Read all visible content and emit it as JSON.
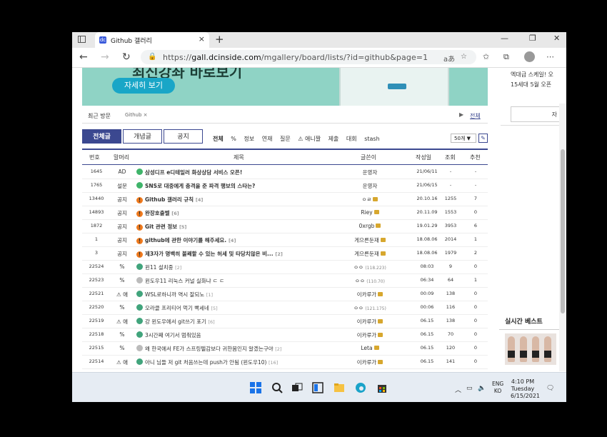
{
  "browser": {
    "tab_title": "Github 갤러리",
    "tab_favicon": "dc",
    "url_prefix": "https://",
    "url_domain": "gall.dcinside.com",
    "url_path": "/mgallery/board/lists/?id=github&page=1",
    "read_aloud": "aあ"
  },
  "banner": {
    "partial_title": "최신강좌 바로보기",
    "button": "자세히 보기"
  },
  "recent": {
    "label": "최근 방문",
    "item": "Github",
    "all_label": "전체"
  },
  "right_column": {
    "line1": "엑대급 스케일! 오",
    "line2": "15세대 5월 오픈",
    "box_text": "자",
    "best_label": "실시간 베스트"
  },
  "board": {
    "tabs": [
      "전체글",
      "개념글",
      "공지"
    ],
    "filters": [
      "전체",
      "%",
      "정보",
      "연재",
      "질문",
      "⚠ 애니짤",
      "제출",
      "대회",
      "stash"
    ],
    "per_page": "50개",
    "columns": [
      "번호",
      "말머리",
      "제목",
      "글쓴이",
      "작성일",
      "조회",
      "추천"
    ],
    "rows": [
      {
        "num": "1645",
        "head": "AD",
        "icon": "green",
        "title": "삼성디프 e디테일러 화상상담 서비스 오픈!",
        "count": "",
        "bold": true,
        "writer": "운영자",
        "ip": "",
        "mark": false,
        "date": "21/06/11",
        "views": "-",
        "rec": "-"
      },
      {
        "num": "1765",
        "head": "설문",
        "icon": "green",
        "title": "SNS로 대중에게 충격을 준 파격 행보의 스타는?",
        "count": "",
        "bold": true,
        "writer": "운영자",
        "ip": "",
        "mark": false,
        "date": "21/06/15",
        "views": "-",
        "rec": "-"
      },
      {
        "num": "13440",
        "head": "공지",
        "icon": "orange",
        "title": "Github 갤러리 규칙",
        "count": "[4]",
        "bold": true,
        "writer": "ㅇㄹ",
        "ip": "",
        "mark": true,
        "date": "20.10.16",
        "views": "1255",
        "rec": "7"
      },
      {
        "num": "14893",
        "head": "공지",
        "icon": "orange",
        "title": "완장호출벨",
        "count": "[6]",
        "bold": true,
        "writer": "Riey",
        "ip": "",
        "mark": true,
        "date": "20.11.09",
        "views": "1553",
        "rec": "0"
      },
      {
        "num": "1872",
        "head": "공지",
        "icon": "orange",
        "title": "Git 관련 정보",
        "count": "[5]",
        "bold": true,
        "writer": "0xrgb",
        "ip": "",
        "mark": true,
        "date": "19.01.29",
        "views": "3953",
        "rec": "6"
      },
      {
        "num": "1",
        "head": "공지",
        "icon": "orange",
        "title": "github에 관한 이야기를 해주세요.",
        "count": "[4]",
        "bold": true,
        "writer": "게으른둔재",
        "ip": "",
        "mark": true,
        "date": "18.08.06",
        "views": "2014",
        "rec": "1"
      },
      {
        "num": "3",
        "head": "공지",
        "icon": "orange",
        "title": "제3자가 명백히 불쾌할 수 있는 허세 및 타당치않은 비...",
        "count": "[2]",
        "bold": true,
        "writer": "게으른둔재",
        "ip": "",
        "mark": true,
        "date": "18.08.06",
        "views": "1979",
        "rec": "2"
      },
      {
        "num": "22524",
        "head": "%",
        "icon": "teal",
        "title": "윈11 설치중",
        "count": "[2]",
        "bold": false,
        "writer": "ㅇㅇ",
        "ip": "(118.223)",
        "mark": false,
        "date": "08:03",
        "views": "9",
        "rec": "0"
      },
      {
        "num": "22523",
        "head": "%",
        "icon": "gray",
        "title": "윈도우11 리눅스 커널 실화냐 ㄷ ㄷ",
        "count": "",
        "bold": false,
        "writer": "ㅇㅇ",
        "ip": "(110.70)",
        "mark": false,
        "date": "06:34",
        "views": "64",
        "rec": "1"
      },
      {
        "num": "22521",
        "head": "⚠ 애",
        "icon": "teal",
        "title": "WSL로하니까 역시 잘되노",
        "count": "[1]",
        "bold": false,
        "writer": "이카루가",
        "ip": "",
        "mark": true,
        "date": "00:09",
        "views": "138",
        "rec": "0"
      },
      {
        "num": "22520",
        "head": "%",
        "icon": "teal",
        "title": "오라클 프리티어 먹기 빡세네",
        "count": "[5]",
        "bold": false,
        "writer": "ㅇㅇ",
        "ip": "(121.175)",
        "mark": false,
        "date": "00:06",
        "views": "116",
        "rec": "0"
      },
      {
        "num": "22519",
        "head": "⚠ 애",
        "icon": "teal",
        "title": "강 윈도우에서 git쓰기 포기",
        "count": "[6]",
        "bold": false,
        "writer": "이카루가",
        "ip": "",
        "mark": true,
        "date": "06.15",
        "views": "138",
        "rec": "0"
      },
      {
        "num": "22518",
        "head": "%",
        "icon": "teal",
        "title": "3시간째 여기서 멈춰있음",
        "count": "",
        "bold": false,
        "writer": "이카루가",
        "ip": "",
        "mark": true,
        "date": "06.15",
        "views": "70",
        "rec": "0"
      },
      {
        "num": "22515",
        "head": "%",
        "icon": "gray",
        "title": "왜 한국에서 FE가 스프링텔감보다 귀한몸인지 알겠는구야",
        "count": "[2]",
        "bold": false,
        "writer": "Leta",
        "ip": "",
        "mark": true,
        "date": "06.15",
        "views": "120",
        "rec": "0"
      },
      {
        "num": "22514",
        "head": "⚠ 애",
        "icon": "teal",
        "title": "아니 님들 저 git 처음쓰는데 push가 안됨 (윈도우10)",
        "count": "[16]",
        "bold": false,
        "writer": "이카루가",
        "ip": "",
        "mark": true,
        "date": "06.15",
        "views": "141",
        "rec": "0"
      }
    ]
  },
  "taskbar": {
    "lang1": "ENG",
    "lang2": "KO",
    "time": "4:10 PM",
    "day": "Tuesday",
    "date": "6/15/2021"
  }
}
